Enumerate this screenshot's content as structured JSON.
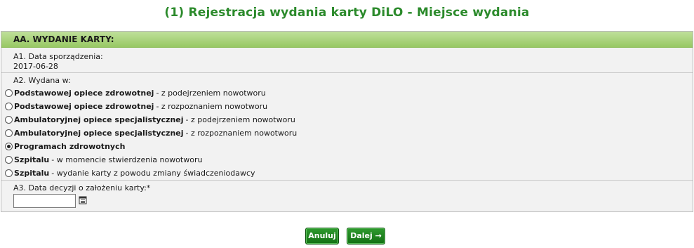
{
  "page": {
    "title": "(1) Rejestracja wydania karty DiLO - Miejsce wydania"
  },
  "section": {
    "header": "AA. WYDANIE KARTY:"
  },
  "a1": {
    "label": "A1. Data sporządzenia:",
    "value": "2017-06-28"
  },
  "a2": {
    "label": "A2. Wydana w:",
    "options": [
      {
        "bold": "Podstawowej opiece zdrowotnej",
        "rest": "- z podejrzeniem nowotworu",
        "checked": false
      },
      {
        "bold": "Podstawowej opiece zdrowotnej",
        "rest": "- z rozpoznaniem nowotworu",
        "checked": false
      },
      {
        "bold": "Ambulatoryjnej opiece specjalistycznej",
        "rest": "- z podejrzeniem nowotworu",
        "checked": false
      },
      {
        "bold": "Ambulatoryjnej opiece specjalistycznej",
        "rest": "- z rozpoznaniem nowotworu",
        "checked": false
      },
      {
        "bold": "Programach zdrowotnych",
        "rest": "",
        "checked": true
      },
      {
        "bold": "Szpitalu",
        "rest": "- w momencie stwierdzenia nowotworu",
        "checked": false
      },
      {
        "bold": "Szpitalu",
        "rest": "- wydanie karty z powodu zmiany świadczeniodawcy",
        "checked": false
      }
    ]
  },
  "a3": {
    "label": "A3. Data decyzji o założeniu karty:*",
    "value": "",
    "icon": "calendar-icon"
  },
  "buttons": {
    "cancel": "Anuluj",
    "next": "Dalej →"
  },
  "colors": {
    "title": "#2b8a2b",
    "header_bg": "#a8d278",
    "button": "#1f841f"
  }
}
